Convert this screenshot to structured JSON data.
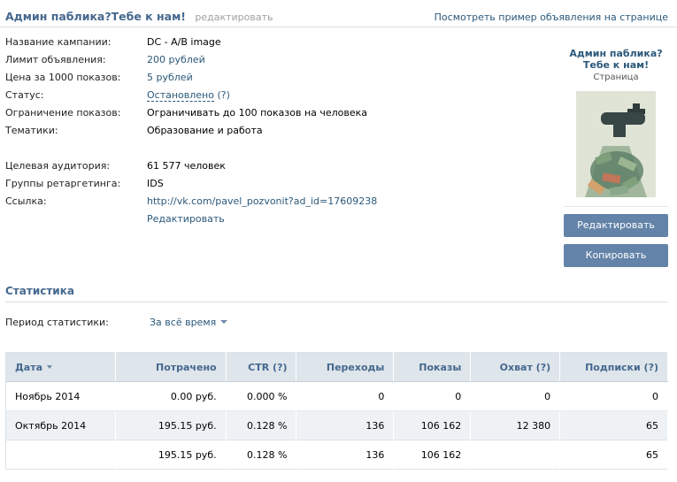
{
  "header": {
    "title": "Админ паблика?Тебе к нам!",
    "edit_label": "редактировать",
    "preview_link": "Посмотреть пример объявления на странице"
  },
  "props": [
    {
      "label": "Название кампании:",
      "value": "DC - A/B image",
      "style": "plain"
    },
    {
      "label": "Лимит объявления:",
      "value": "200 рублей",
      "style": "link"
    },
    {
      "label": "Цена за 1000 показов:",
      "value": "5 рублей",
      "style": "link"
    },
    {
      "label": "Статус:",
      "value": "Остановлено",
      "value_suffix": "(?)",
      "style": "status"
    },
    {
      "label": "Ограничение показов:",
      "value": "Ограничивать до 100 показов на человека",
      "style": "plain"
    },
    {
      "label": "Тематики:",
      "value": "Образование и работа",
      "style": "plain"
    },
    {
      "label": "Целевая аудитория:",
      "value": "61 577 человек",
      "style": "plain"
    },
    {
      "label": "Группы ретаргетинга:",
      "value": "IDS",
      "style": "plain"
    },
    {
      "label": "Ссылка:",
      "value": "http://vk.com/pavel_pozvonit?ad_id=17609238",
      "style": "link"
    },
    {
      "label": "",
      "value": "Редактировать",
      "style": "link"
    }
  ],
  "ad_preview": {
    "name": "Админ паблика? Тебе к нам!",
    "type": "Страница"
  },
  "buttons": {
    "edit": "Редактировать",
    "copy": "Копировать"
  },
  "stats": {
    "title": "Статистика",
    "period_label": "Период статистики:",
    "period_value": "За всё время",
    "columns": [
      "Дата",
      "Потрачено",
      "CTR (?)",
      "Переходы",
      "Показы",
      "Охват (?)",
      "Подписки (?)"
    ],
    "rows": [
      [
        "Ноябрь 2014",
        "0.00 руб.",
        "0.000 %",
        "0",
        "0",
        "0",
        "0"
      ],
      [
        "Октябрь 2014",
        "195.15 руб.",
        "0.128 %",
        "136",
        "106 162",
        "12 380",
        "65"
      ]
    ],
    "total": [
      "",
      "195.15 руб.",
      "0.128 %",
      "136",
      "106 162",
      "",
      "65"
    ]
  },
  "colors": {
    "link": "#2b587a",
    "title": "#45688e",
    "button": "#6383a8",
    "table_header": "#dee5eb"
  }
}
